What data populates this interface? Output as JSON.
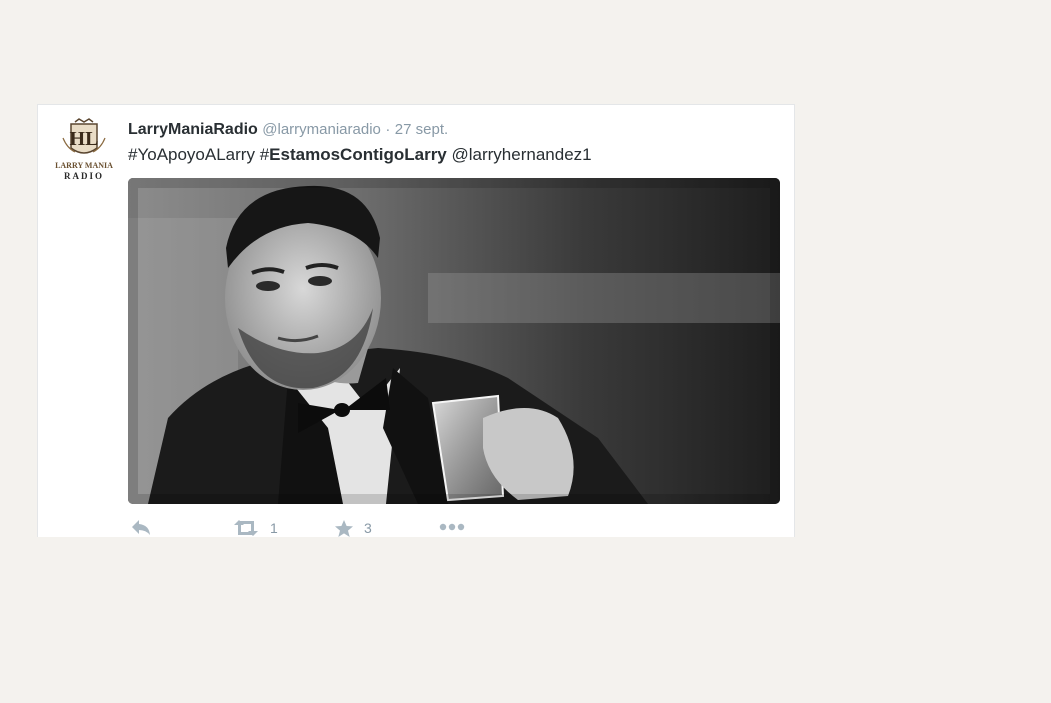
{
  "tweet": {
    "avatar": {
      "logo_line1": "LARRY MANIA",
      "logo_line2": "RADIO"
    },
    "display_name": "LarryManiaRadio",
    "handle": "@larrymaniaradio",
    "separator": "·",
    "timestamp": "27 sept.",
    "text": {
      "hashtag1": "#YoApoyoALarry",
      "hash_symbol": "#",
      "hashtag2": "EstamosContigoLarry",
      "mention": "@larryhernandez1"
    },
    "actions": {
      "reply_icon": "reply-icon",
      "retweet_icon": "retweet-icon",
      "retweet_count": "1",
      "favorite_icon": "star-icon",
      "favorite_count": "3",
      "more_icon": "more-icon"
    }
  },
  "colors": {
    "page_background": "#f4f2ee",
    "card_background": "#ffffff",
    "text_primary": "#292f33",
    "text_secondary": "#8899a6",
    "icon_gray": "#aab8c2"
  }
}
